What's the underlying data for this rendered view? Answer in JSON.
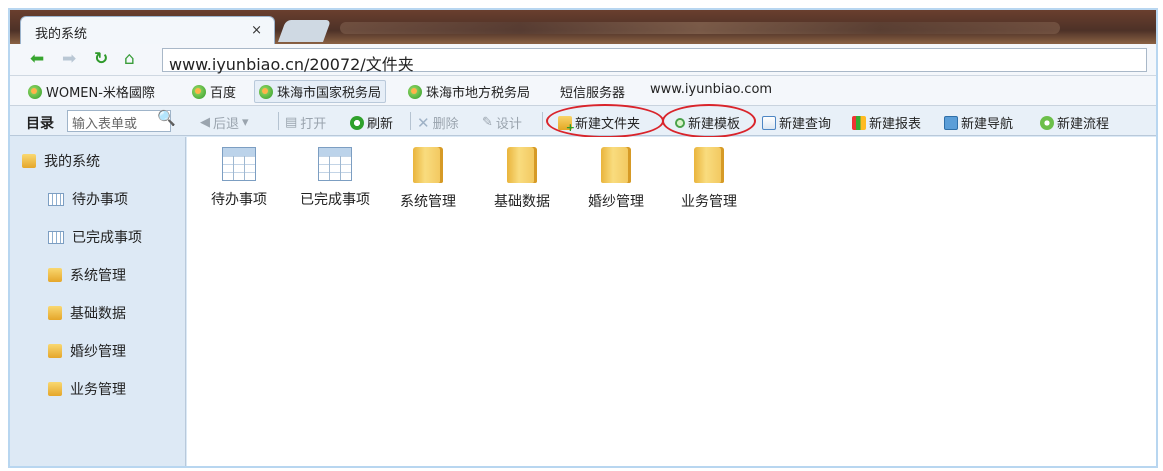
{
  "browser": {
    "tab_title": "我的系统",
    "tab_close": "×",
    "address": "www.iyunbiao.cn/20072/文件夹"
  },
  "bookmarks": [
    {
      "label": "WOMEN-米格國際",
      "icon": "leaf-icon"
    },
    {
      "label": "百度",
      "icon": "leaf-icon"
    },
    {
      "label": "珠海市国家税务局",
      "icon": "leaf-icon"
    },
    {
      "label": "珠海市地方税务局",
      "icon": "leaf-icon"
    },
    {
      "label": "短信服务器",
      "icon": ""
    },
    {
      "label": "www.iyunbiao.com",
      "icon": ""
    }
  ],
  "toolbar": {
    "catalog_label": "目录",
    "search_placeholder": "输入表单或",
    "back": "后退",
    "open": "打开",
    "refresh": "刷新",
    "delete": "删除",
    "design": "设计",
    "new_folder": "新建文件夹",
    "new_template": "新建模板",
    "new_query": "新建查询",
    "new_report": "新建报表",
    "new_nav": "新建导航",
    "new_flow": "新建流程"
  },
  "sidebar": {
    "root": "我的系统",
    "items": [
      {
        "label": "待办事项",
        "icon": "grid-icon"
      },
      {
        "label": "已完成事项",
        "icon": "grid-icon"
      },
      {
        "label": "系统管理",
        "icon": "folder-icon"
      },
      {
        "label": "基础数据",
        "icon": "folder-icon"
      },
      {
        "label": "婚纱管理",
        "icon": "folder-icon"
      },
      {
        "label": "业务管理",
        "icon": "folder-icon"
      }
    ]
  },
  "content": {
    "items": [
      {
        "label": "待办事项",
        "icon": "grid-icon"
      },
      {
        "label": "已完成事项",
        "icon": "grid-icon"
      },
      {
        "label": "系统管理",
        "icon": "folder-icon"
      },
      {
        "label": "基础数据",
        "icon": "folder-icon"
      },
      {
        "label": "婚纱管理",
        "icon": "folder-icon"
      },
      {
        "label": "业务管理",
        "icon": "folder-icon"
      }
    ]
  },
  "colors": {
    "highlight_circle": "#d9242b",
    "sidebar_bg": "#dde9f5"
  }
}
